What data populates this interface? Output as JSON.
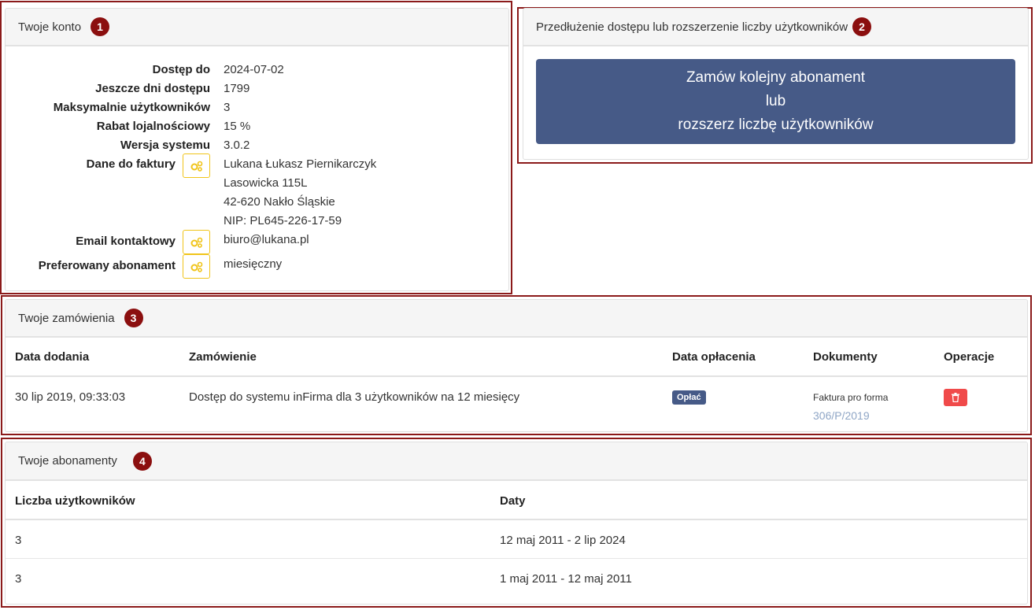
{
  "account": {
    "title": "Twoje konto",
    "badge": "1",
    "rows": [
      {
        "label": "Dostęp do",
        "value": "2024-07-02"
      },
      {
        "label": "Jeszcze dni dostępu",
        "value": "1799"
      },
      {
        "label": "Maksymalnie użytkowników",
        "value": "3"
      },
      {
        "label": "Rabat lojalnościowy",
        "value": "15 %"
      },
      {
        "label": "Wersja systemu",
        "value": "3.0.2"
      }
    ],
    "invoice_label": "Dane do faktury",
    "invoice_lines": [
      "Lukana Łukasz Piernikarczyk",
      "Lasowicka 115L",
      "42-620 Nakło Śląskie",
      "NIP: PL645-226-17-59"
    ],
    "email_label": "Email kontaktowy",
    "email_value": "biuro@lukana.pl",
    "plan_label": "Preferowany abonament",
    "plan_value": "miesięczny"
  },
  "extend": {
    "title": "Przedłużenie dostępu lub rozszerzenie liczby użytkowników",
    "badge": "2",
    "button_lines": [
      "Zamów kolejny abonament",
      "lub",
      "rozszerz liczbę użytkowników"
    ]
  },
  "orders": {
    "title": "Twoje zamówienia",
    "badge": "3",
    "columns": [
      "Data dodania",
      "Zamówienie",
      "Data opłacenia",
      "Dokumenty",
      "Operacje"
    ],
    "rows": [
      {
        "date": "30 lip 2019, 09:33:03",
        "order": "Dostęp do systemu inFirma dla 3 użytkowników na 12 miesięcy",
        "pay_label": "Opłać",
        "doc_type": "Faktura pro forma",
        "doc_number": "306/P/2019"
      }
    ]
  },
  "subscriptions": {
    "title": "Twoje abonamenty",
    "badge": "4",
    "columns": [
      "Liczba użytkowników",
      "Daty"
    ],
    "rows": [
      {
        "users": "3",
        "dates": "12 maj 2011 - 2 lip 2024"
      },
      {
        "users": "3",
        "dates": "1 maj 2011 - 12 maj 2011"
      }
    ]
  },
  "colors": {
    "highlight": "#8b1a1a",
    "primary": "#465a87",
    "danger": "#f04a4a",
    "warning": "#f0c419"
  },
  "icons": {
    "settings": "gears-icon",
    "delete": "trash-icon"
  }
}
